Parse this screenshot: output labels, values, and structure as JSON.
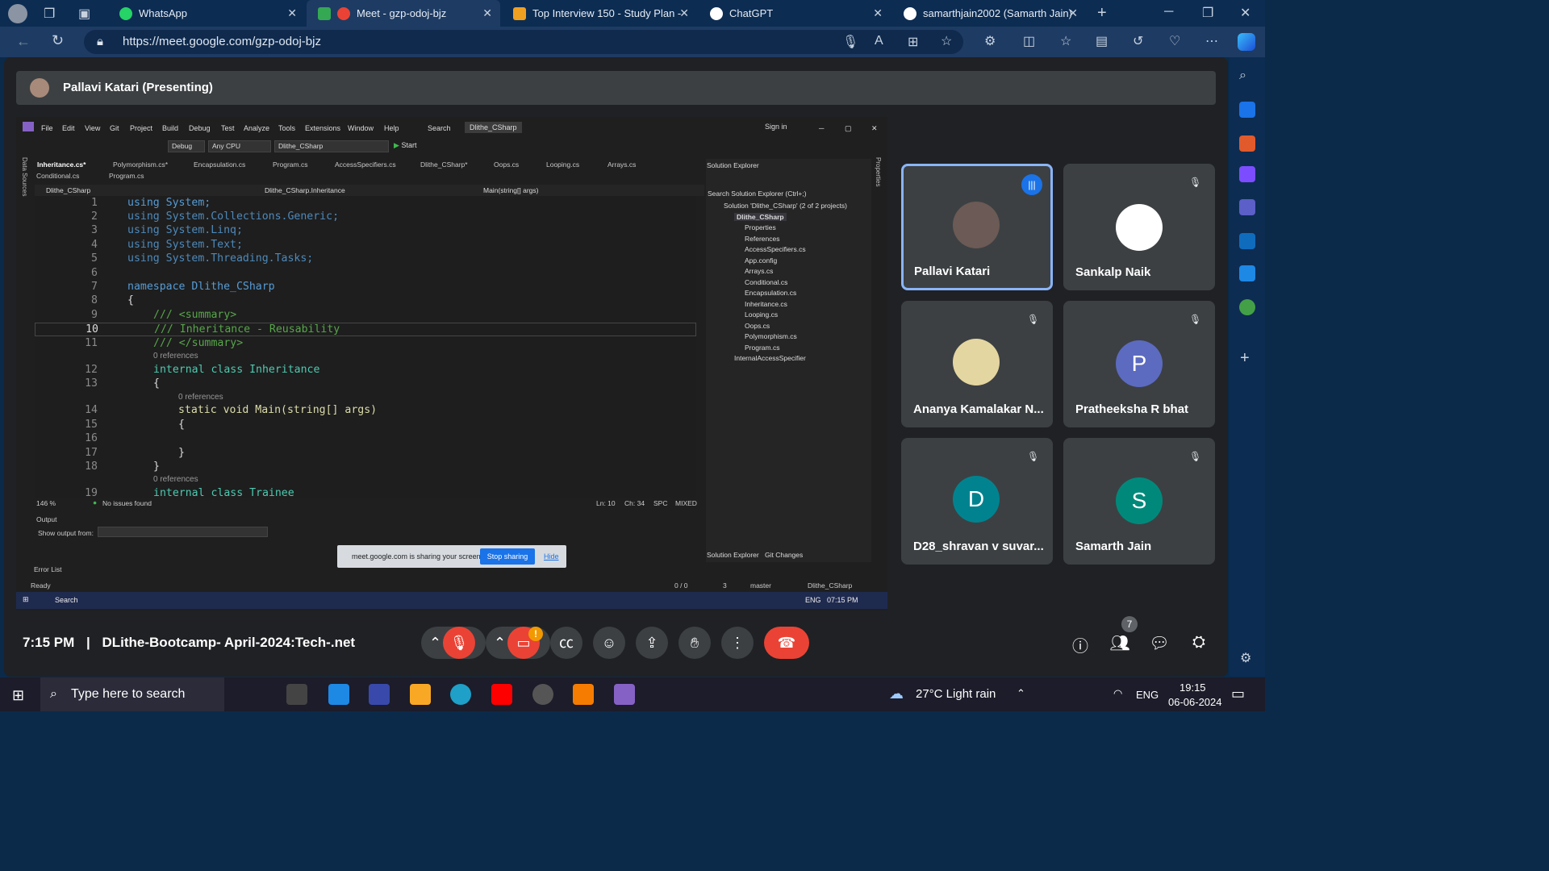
{
  "browser": {
    "tabs": [
      {
        "label": "WhatsApp",
        "color": "#25d366"
      },
      {
        "label": "Meet - gzp-odoj-bjz",
        "color": "#ea4335"
      },
      {
        "label": "Top Interview 150 - Study Plan -",
        "color": "#f0a020"
      },
      {
        "label": "ChatGPT",
        "color": "#ffffff"
      },
      {
        "label": "samarthjain2002 (Samarth Jain)",
        "color": "#ffffff"
      }
    ],
    "url": "https://meet.google.com/gzp-odoj-bjz"
  },
  "meet": {
    "presenter_label": "Pallavi Katari (Presenting)",
    "time": "7:15 PM",
    "separator": "|",
    "meeting_name": "DLithe-Bootcamp- April-2024:Tech-.net",
    "participant_count": "7",
    "participants": [
      {
        "name": "Pallavi Katari",
        "initial": "",
        "color": "#6b5a55",
        "speaking": true
      },
      {
        "name": "Sankalp Naik",
        "initial": "",
        "color": "#ffffff",
        "speaking": false
      },
      {
        "name": "Ananya Kamalakar N...",
        "initial": "",
        "color": "#e4d6a0",
        "speaking": false
      },
      {
        "name": "Pratheeksha R bhat",
        "initial": "P",
        "color": "#5c6bc0",
        "speaking": false
      },
      {
        "name": "D28_shravan v suvar...",
        "initial": "D",
        "color": "#00838f",
        "speaking": false
      },
      {
        "name": "Samarth Jain",
        "initial": "S",
        "color": "#00897b",
        "speaking": false
      }
    ],
    "share_toast": {
      "text": "meet.google.com is sharing your screen.",
      "stop": "Stop sharing",
      "hide": "Hide"
    }
  },
  "vs": {
    "menu": [
      "File",
      "Edit",
      "View",
      "Git",
      "Project",
      "Build",
      "Debug",
      "Test",
      "Analyze",
      "Tools",
      "Extensions",
      "Window",
      "Help"
    ],
    "search": "Search",
    "solution_name": "Dlithe_CSharp",
    "sign_in": "Sign in",
    "config": "Debug",
    "platform": "Any CPU",
    "project": "Dlithe_CSharp",
    "start": "Start",
    "doc_tabs": [
      "Inheritance.cs*",
      "Polymorphism.cs*",
      "Encapsulation.cs",
      "Program.cs",
      "AccessSpecifiers.cs",
      "Dlithe_CSharp*",
      "Oops.cs",
      "Looping.cs",
      "Arrays.cs"
    ],
    "doc_tabs_row2": [
      "Conditional.cs",
      "Program.cs"
    ],
    "nav": [
      "Dlithe_CSharp",
      "Dlithe_CSharp.Inheritance",
      "Main(string[] args)"
    ],
    "code_lines": [
      {
        "n": "1",
        "text": "using System;"
      },
      {
        "n": "2",
        "text": "using System.Collections.Generic;"
      },
      {
        "n": "3",
        "text": "using System.Linq;"
      },
      {
        "n": "4",
        "text": "using System.Text;"
      },
      {
        "n": "5",
        "text": "using System.Threading.Tasks;"
      },
      {
        "n": "6",
        "text": ""
      },
      {
        "n": "7",
        "text": "namespace Dlithe_CSharp"
      },
      {
        "n": "8",
        "text": "{"
      },
      {
        "n": "9",
        "text": "/// <summary>"
      },
      {
        "n": "10",
        "text": "/// Inheritance - Reusability"
      },
      {
        "n": "11",
        "text": "/// </summary>"
      },
      {
        "n": "12",
        "text": "internal class Inheritance"
      },
      {
        "n": "13",
        "text": "{"
      },
      {
        "n": "14",
        "text": "static void Main(string[] args)"
      },
      {
        "n": "15",
        "text": "{"
      },
      {
        "n": "16",
        "text": ""
      },
      {
        "n": "17",
        "text": "}"
      },
      {
        "n": "18",
        "text": "}"
      },
      {
        "n": "19",
        "text": "internal class Trainee"
      }
    ],
    "references": "0 references",
    "zoom": "146 %",
    "issues": "No issues found",
    "position": "Ln: 10",
    "column": "Ch: 34",
    "spc": "SPC",
    "eol": "MIXED",
    "output_title": "Output",
    "output_from": "Show output from:",
    "error_list": "Error List",
    "ready": "Ready",
    "git_counts": "0 / 0",
    "edits": "3",
    "branch": "master",
    "solution_explorer": {
      "title": "Solution Explorer",
      "search": "Search Solution Explorer (Ctrl+;)",
      "solution": "Solution 'Dlithe_CSharp' (2 of 2 projects)",
      "project": "Dlithe_CSharp",
      "items": [
        "Properties",
        "References",
        "AccessSpecifiers.cs",
        "App.config",
        "Arrays.cs",
        "Conditional.cs",
        "Encapsulation.cs",
        "Inheritance.cs",
        "Looping.cs",
        "Oops.cs",
        "Polymorphism.cs",
        "Program.cs"
      ],
      "project2": "InternalAccessSpecifier",
      "tab1": "Solution Explorer",
      "tab2": "Git Changes"
    },
    "side_label_left": "Data Sources",
    "side_label_right": "Properties",
    "inner_taskbar": {
      "search": "Search",
      "lang": "ENG",
      "time": "07:15 PM"
    }
  },
  "taskbar": {
    "search_placeholder": "Type here to search",
    "weather": "27°C  Light rain",
    "lang": "ENG",
    "time": "19:15",
    "date": "06-06-2024"
  }
}
